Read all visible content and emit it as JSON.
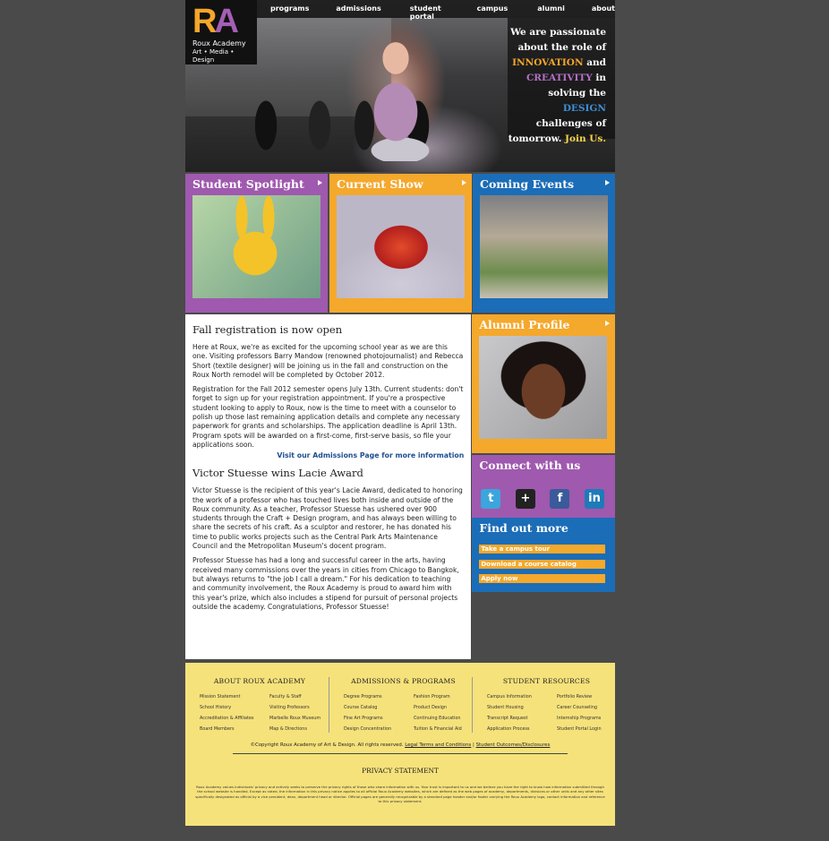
{
  "logo": {
    "mark_r": "R",
    "mark_a": "A",
    "name": "Roux Academy",
    "tagline": "Art • Media • Design"
  },
  "nav": [
    "programs",
    "admissions",
    "student portal",
    "campus",
    "alumni",
    "about"
  ],
  "hero_tagline": {
    "l1": "We are passionate",
    "l2": "about the role of",
    "innovation": "INNOVATION",
    "and": " and",
    "creativity": "CREATIVITY",
    "in": " in",
    "solving": "solving the ",
    "design": "DESIGN",
    "challenges": "challenges of",
    "tomorrow": "tomorrow. ",
    "join": "Join Us."
  },
  "tiles": [
    {
      "title": "Student Spotlight"
    },
    {
      "title": "Current Show"
    },
    {
      "title": "Coming Events"
    }
  ],
  "article": {
    "h1": "Fall registration is now open",
    "p1": "Here at Roux, we're as excited for the upcoming school year as we are this one. Visiting professors Barry Mandow (renowned photojournalist) and Rebecca Short (textile designer) will be joining us in the fall and construction on the Roux North remodel will be completed by October 2012.",
    "p2": "Registration for the Fall 2012 semester opens July 13th. Current students: don't forget to sign up for your registration appointment. If you're a prospective student looking to apply to Roux, now is the time to meet with a counselor to polish up those last remaining application details and complete any necessary paperwork for grants and scholarships. The application deadline is April 13th. Program spots will be awarded on a first-come, first-serve basis, so file your applications soon.",
    "more": "Visit our Admissions Page for more information",
    "h2": "Victor Stuesse wins Lacie Award",
    "p3": "Victor Stuesse is the recipient of this year's Lacie Award, dedicated to honoring the work of a professor who has touched lives both inside and outside of the Roux community. As a teacher, Professor Stuesse has ushered over 900 students through the Craft + Design program, and has always been willing to share the secrets of his craft. As a sculptor and restorer, he has donated his time to public works projects such as the Central Park Arts Maintenance Council and the Metropolitan Museum's docent program.",
    "p4": "Professor Stuesse has had a long and successful career in the arts, having received many commissions over the years in cities from Chicago to Bangkok, but always returns to \"the job I call a dream.\" For his dedication to teaching and community involvement, the Roux Academy is proud to award him with this year's prize, which also includes a stipend for pursuit of personal projects outside the academy. Congratulations, Professor Stuesse!"
  },
  "sidebar": {
    "alumni_title": "Alumni Profile",
    "connect_title": "Connect with us",
    "social": [
      "twitter",
      "google-plus",
      "facebook",
      "linkedin"
    ],
    "social_glyphs": {
      "twitter": "t",
      "google_plus": "+",
      "facebook": "f",
      "linkedin": "in"
    },
    "findout_title": "Find out more",
    "links": [
      "Take a campus tour",
      "Download a course catalog",
      "Apply now"
    ]
  },
  "footer": {
    "col1": {
      "title": "ABOUT ROUX ACADEMY",
      "items": [
        "Mission Statement",
        "Faculty & Staff",
        "School History",
        "Visiting Professors",
        "Accreditation & Affiliates",
        "Marbelle Roux Museum",
        "Board Members",
        "Map & Directions"
      ]
    },
    "col2": {
      "title": "ADMISSIONS & PROGRAMS",
      "items": [
        "Degree Programs",
        "Fashion Program",
        "Course Catalog",
        "Product Design",
        "Fine Art Programs",
        "Continuing Education",
        "Design Concentration",
        "Tuition & Financial Aid"
      ]
    },
    "col3": {
      "title": "STUDENT RESOURCES",
      "items": [
        "Campus Information",
        "Portfolio Review",
        "Student Housing",
        "Career Counseling",
        "Transcript Request",
        "Internship Programs",
        "Application Process",
        "Student Portal Login"
      ]
    },
    "copyright": "©Copyright Roux Academy of Art & Design. All rights reserved.",
    "legal": "Legal Terms and Conditions",
    "sep": "|",
    "outcomes": "Student Outcomes/Disclosures",
    "privacy_title": "PRIVACY STATEMENT",
    "privacy_text": "Roux Academy values individuals' privacy and actively seeks to preserve the privacy rights of those who share information with us. Your trust is important to us and we believe you have the right to know how information submitted through the school website is handled. Except as noted, the information in this privacy notice applies to all official Roux Academy websites, which are defined as the web pages of academy, departments, divisions or other units and any other sites specifically designated as official by a vice president, dean, department head or director. Official pages are generally recognizable by a standard page header and/or footer carrying the Roux Academy logo, contact information and reference to this privacy statement."
  },
  "colors": {
    "purple": "#9f59ae",
    "orange": "#f4a82c",
    "blue": "#1b6db7",
    "footer": "#f6e27b",
    "background": "#4a4a4b"
  }
}
